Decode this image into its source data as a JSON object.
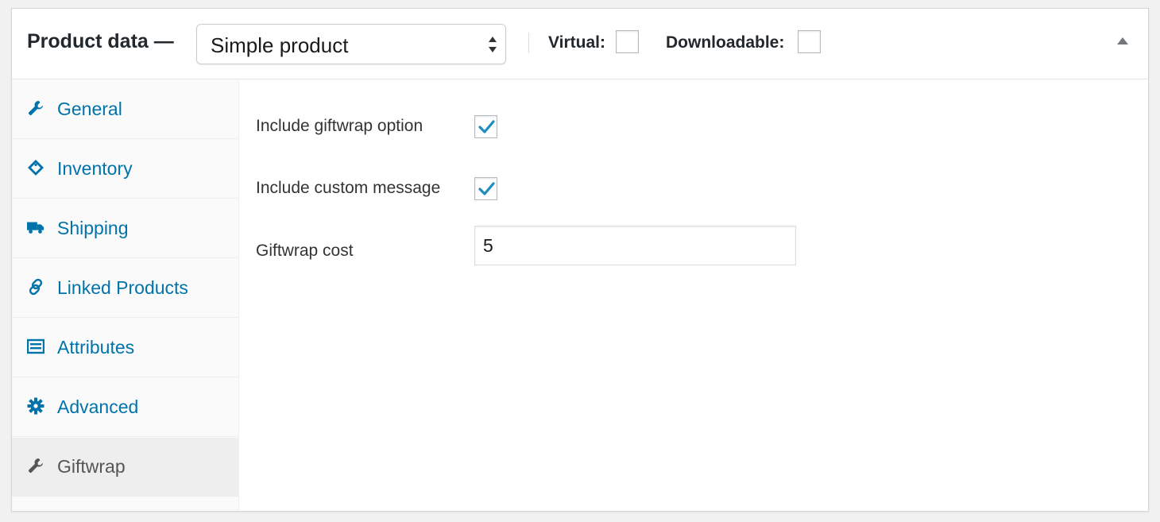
{
  "header": {
    "title": "Product data —",
    "product_type": "Simple product",
    "virtual_label": "Virtual:",
    "downloadable_label": "Downloadable:",
    "virtual_checked": false,
    "downloadable_checked": false
  },
  "tabs": [
    {
      "label": "General",
      "icon": "wrench-icon"
    },
    {
      "label": "Inventory",
      "icon": "tag-icon"
    },
    {
      "label": "Shipping",
      "icon": "truck-icon"
    },
    {
      "label": "Linked Products",
      "icon": "link-icon"
    },
    {
      "label": "Attributes",
      "icon": "list-icon"
    },
    {
      "label": "Advanced",
      "icon": "gear-icon"
    },
    {
      "label": "Giftwrap",
      "icon": "wrench-icon",
      "active": true
    }
  ],
  "fields": {
    "giftwrap_option_label": "Include giftwrap option",
    "giftwrap_option_checked": true,
    "custom_message_label": "Include custom message",
    "custom_message_checked": true,
    "giftwrap_cost_label": "Giftwrap cost",
    "giftwrap_cost_value": "5"
  },
  "colors": {
    "link": "#0073aa",
    "active_tab_text": "#555555",
    "checkmark": "#1e8cbe"
  }
}
